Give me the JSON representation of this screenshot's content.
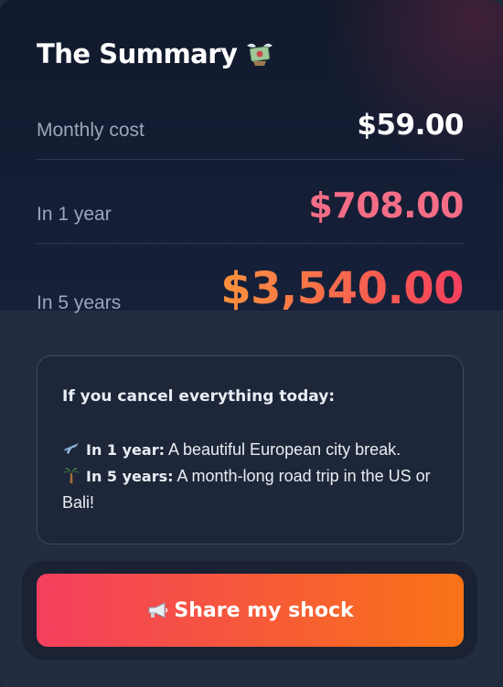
{
  "summary": {
    "title": "The Summary",
    "title_icon": "money-with-wings-icon",
    "rows": [
      {
        "label": "Monthly cost",
        "value": "$59.00"
      },
      {
        "label": "In 1 year",
        "value": "$708.00"
      },
      {
        "label": "In 5 years",
        "value": "$3,540.00"
      }
    ]
  },
  "info": {
    "heading": "If you cancel everything today:",
    "items": [
      {
        "icon": "airplane-icon",
        "label": "In 1 year:",
        "text": " A beautiful European city break."
      },
      {
        "icon": "palm-tree-icon",
        "label": "In 5 years:",
        "text": " A month-long road trip in the US or Bali!"
      }
    ]
  },
  "share_button": {
    "icon": "megaphone-icon",
    "label": "Share my shock"
  },
  "colors": {
    "accent_pink": "#f46d86",
    "gradient_start": "#f43f5e",
    "gradient_end": "#f97316"
  }
}
